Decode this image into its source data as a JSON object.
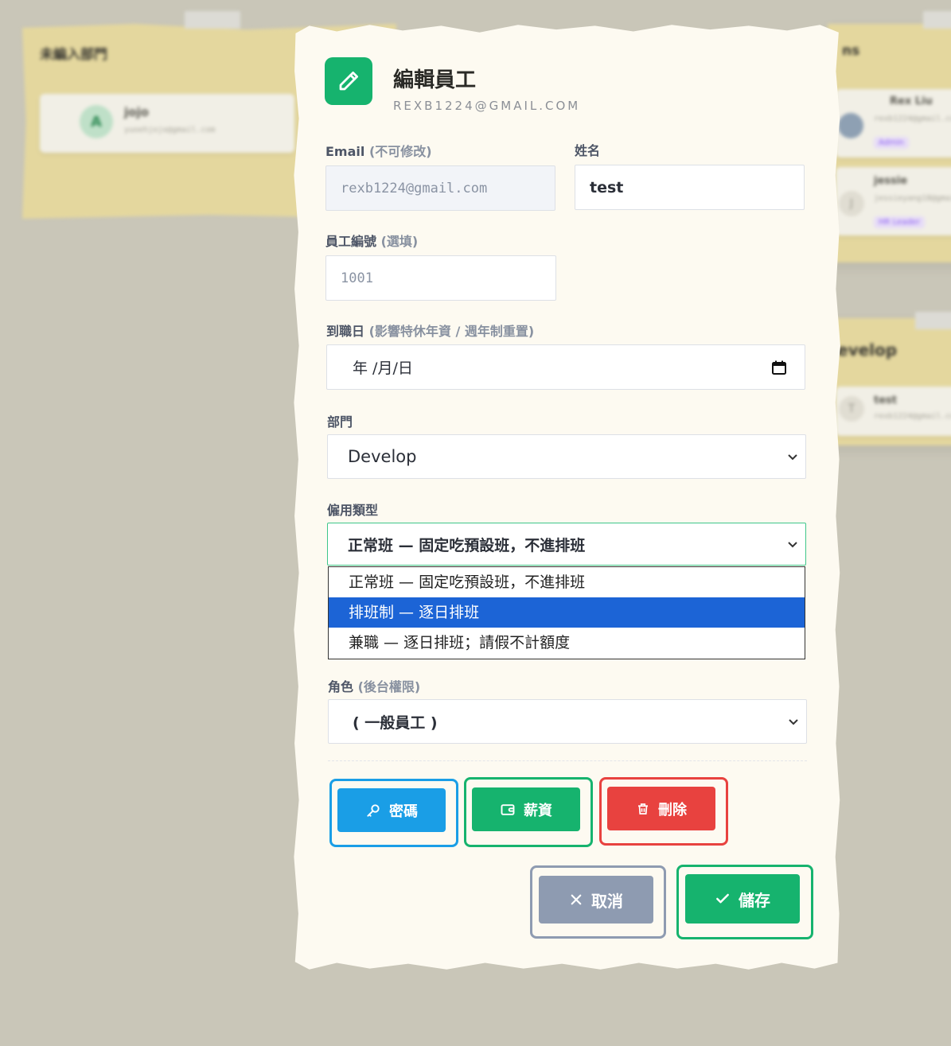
{
  "background": {
    "left_column_title": "未編入部門",
    "left_card": {
      "avatar": "A",
      "name": "jojo",
      "email": "yuoehjojo@gmail.com"
    },
    "right_column_title": "ns",
    "right_cards": [
      {
        "name": "Rex Liu",
        "email": "rexb1224@gmail.com",
        "badge": "Admin"
      },
      {
        "avatar": "J",
        "name": "jessie",
        "email": "jessieyang18@gmail.com",
        "badge": "HR Leader"
      }
    ],
    "right_column2_title": "evelop",
    "right_card2": {
      "avatar": "T",
      "name": "test",
      "email": "rexb1224@gmail.com"
    }
  },
  "modal": {
    "title": "編輯員工",
    "subtitle": "REXB1224@GMAIL.COM",
    "email": {
      "label": "Email",
      "hint": "(不可修改)",
      "value": "rexb1224@gmail.com"
    },
    "name": {
      "label": "姓名",
      "value": "test"
    },
    "employee_no": {
      "label": "員工編號",
      "hint": "(選填)",
      "placeholder": "1001"
    },
    "hire_date": {
      "label": "到職日",
      "hint": "(影響特休年資 / 週年制重置)",
      "value": "年 /月/日"
    },
    "department": {
      "label": "部門",
      "value": "Develop"
    },
    "employment_type": {
      "label": "僱用類型",
      "value": "正常班 — 固定吃預設班，不進排班",
      "options": [
        "正常班 — 固定吃預設班，不進排班",
        "排班制 — 逐日排班",
        "兼職 — 逐日排班；請假不計額度"
      ],
      "highlighted_index": 1
    },
    "role": {
      "label": "角色",
      "hint": "(後台權限)",
      "value": "( 一般員工 )"
    },
    "buttons": {
      "password": "密碼",
      "salary": "薪資",
      "delete": "刪除",
      "cancel": "取消",
      "save": "儲存"
    },
    "colors": {
      "accent": "#16b36e",
      "blue": "#1a9ee6",
      "red": "#e8423f",
      "gray": "#8e9bb1"
    }
  }
}
